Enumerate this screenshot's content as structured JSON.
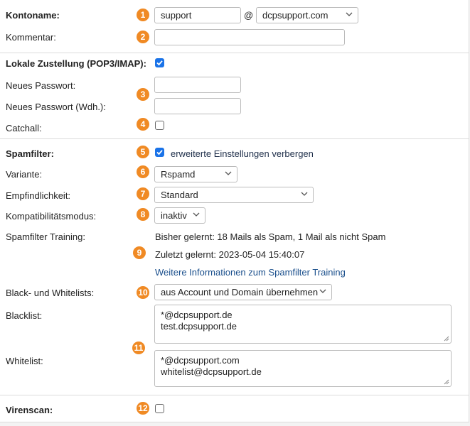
{
  "account": {
    "name_label": "Kontoname:",
    "username_value": "support",
    "at_sign": "@",
    "domain_value": "dcpsupport.com",
    "comment_label": "Kommentar:",
    "comment_value": ""
  },
  "delivery": {
    "label": "Lokale Zustellung (POP3/IMAP):",
    "checked": true,
    "new_password_label": "Neues Passwort:",
    "new_password_repeat_label": "Neues Passwort (Wdh.):",
    "catchall_label": "Catchall:",
    "catchall_checked": false
  },
  "spam": {
    "label": "Spamfilter:",
    "checked": true,
    "advanced_toggle_text": "erweiterte Einstellungen verbergen",
    "variant_label": "Variante:",
    "variant_value": "Rspamd",
    "sensitivity_label": "Empfindlichkeit:",
    "sensitivity_value": "Standard",
    "compat_label": "Kompatibilitätsmodus:",
    "compat_value": "inaktiv",
    "training_label": "Spamfilter Training:",
    "training_learned": "Bisher gelernt: 18 Mails als Spam, 1 Mail als nicht Spam",
    "training_last": "Zuletzt gelernt: 2023-05-04 15:40:07",
    "training_link": "Weitere Informationen zum Spamfilter Training"
  },
  "lists": {
    "label": "Black- und Whitelists:",
    "mode_value": "aus Account und Domain übernehmen",
    "blacklist_label": "Blacklist:",
    "blacklist_lines": [
      "*@dcpsupport.de",
      "test.dcpsupport.de"
    ],
    "whitelist_label": "Whitelist:",
    "whitelist_lines": [
      "*@dcpsupport.com",
      "whitelist@dcpsupport.de"
    ]
  },
  "virus": {
    "label": "Virenscan:",
    "checked": false
  },
  "badges": [
    "1",
    "2",
    "3",
    "4",
    "5",
    "6",
    "7",
    "8",
    "9",
    "10",
    "11",
    "12"
  ],
  "colors": {
    "badge": "#f08a24",
    "checkbox": "#1a73e8",
    "link": "#1a4f8c"
  }
}
